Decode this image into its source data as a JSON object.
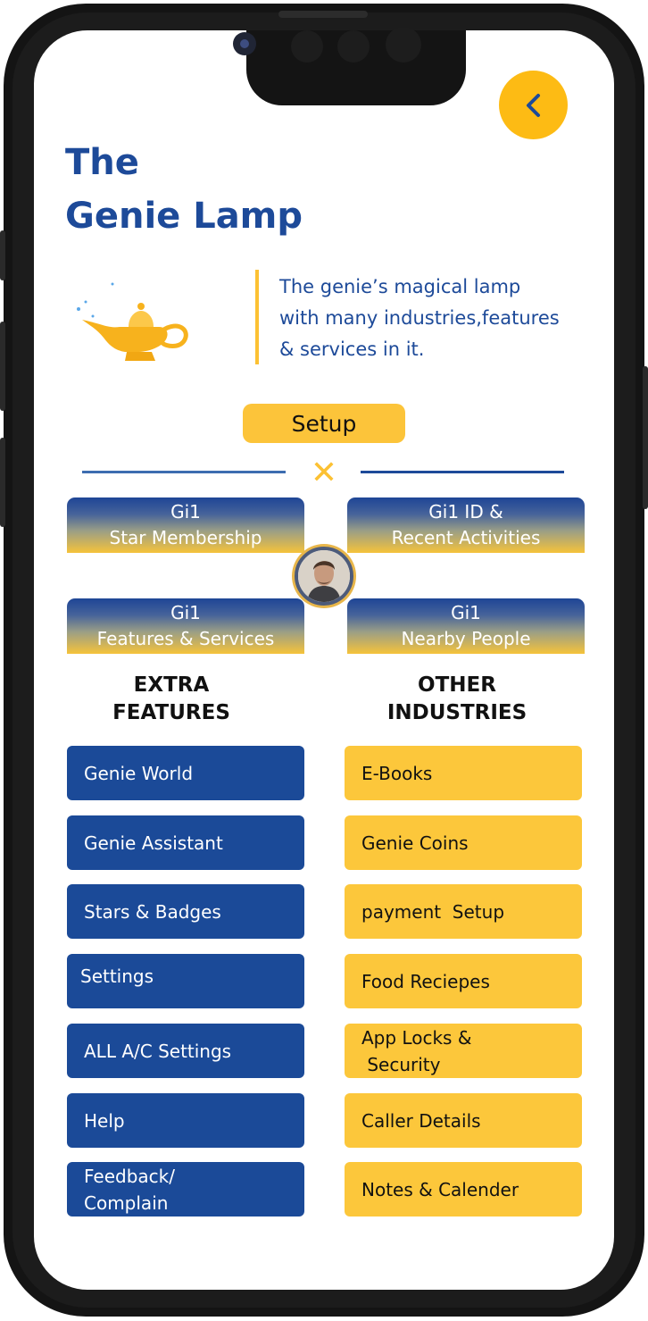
{
  "header": {
    "title_line1": "The",
    "title_line2": "Genie Lamp",
    "back_icon": "chevron-left-icon"
  },
  "intro": {
    "description_line1": "The genie’s magical lamp",
    "description_line2": "with many industries,features",
    "description_line3": "& services in it."
  },
  "setup": {
    "label": "Setup",
    "close_glyph": "✕"
  },
  "quick_buttons": [
    {
      "line1": "Gi1",
      "line2": "Star Membership"
    },
    {
      "line1": "Gi1 ID &",
      "line2": "Recent Activities"
    },
    {
      "line1": "Gi1",
      "line2": "Features & Services"
    },
    {
      "line1": "Gi1",
      "line2": "Nearby People"
    }
  ],
  "extra_features": {
    "heading_line1": "EXTRA",
    "heading_line2": "FEATURES",
    "items": [
      {
        "line1": "Genie World",
        "line2": ""
      },
      {
        "line1": "Genie Assistant",
        "line2": ""
      },
      {
        "line1": "Stars & Badges",
        "line2": ""
      },
      {
        "line1": "Settings",
        "line2": ""
      },
      {
        "line1": "ALL A/C Settings",
        "line2": ""
      },
      {
        "line1": "Help",
        "line2": ""
      },
      {
        "line1": "Feedback/",
        "line2": "Complain"
      }
    ]
  },
  "other_industries": {
    "heading_line1": "OTHER",
    "heading_line2": "INDUSTRIES",
    "items": [
      {
        "line1": "E-Books",
        "line2": ""
      },
      {
        "line1": "Genie Coins",
        "line2": ""
      },
      {
        "line1": "payment  Setup",
        "line2": ""
      },
      {
        "line1": "Food Reciepes",
        "line2": ""
      },
      {
        "line1": "App Locks &",
        "line2": " Security"
      },
      {
        "line1": "Caller Details",
        "line2": ""
      },
      {
        "line1": "Notes & Calender",
        "line2": ""
      }
    ]
  },
  "colors": {
    "brand_blue": "#1d4a99",
    "brand_yellow": "#fcc133"
  }
}
